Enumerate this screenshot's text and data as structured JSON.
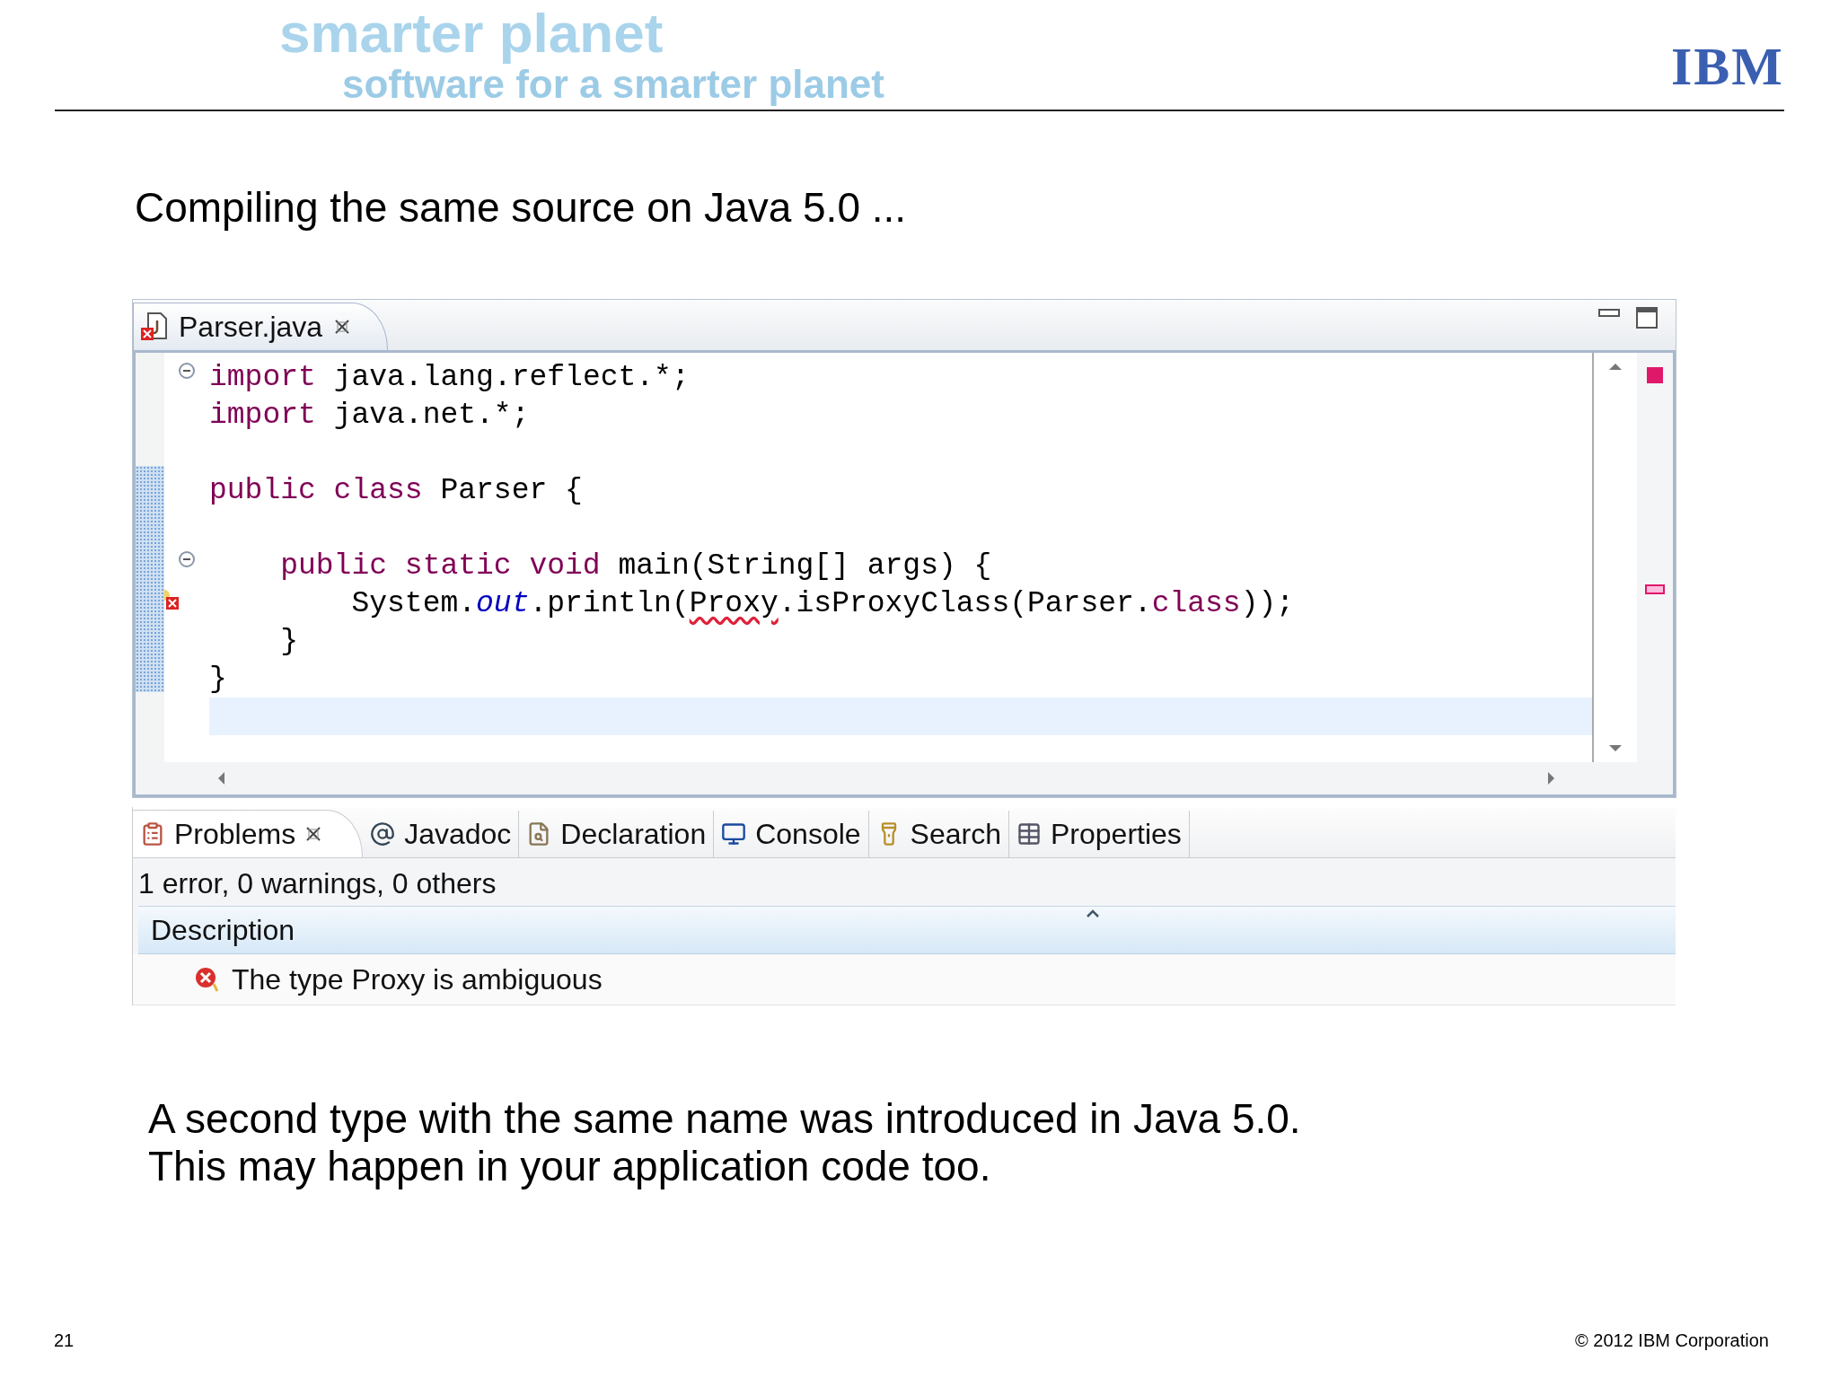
{
  "header": {
    "headline": "smarter planet",
    "tagline": "software for a smarter planet",
    "logo": "IBM"
  },
  "title": "Compiling the same source on Java 5.0 ...",
  "editor": {
    "tabs": [
      {
        "label": "Parser.java",
        "selected": true,
        "error": true
      }
    ],
    "lines": [
      {
        "kind": "code",
        "fold": true,
        "tokens": [
          {
            "text": "import",
            "kind": "keyword"
          },
          {
            "text": " java.lang.reflect.*;",
            "kind": "plain"
          }
        ]
      },
      {
        "kind": "code",
        "tokens": [
          {
            "text": "import",
            "kind": "keyword"
          },
          {
            "text": " java.net.*;",
            "kind": "plain"
          }
        ]
      },
      {
        "kind": "blank"
      },
      {
        "kind": "code",
        "tokens": [
          {
            "text": "public class",
            "kind": "keyword"
          },
          {
            "text": " Parser {",
            "kind": "plain"
          }
        ]
      },
      {
        "kind": "blank"
      },
      {
        "kind": "code",
        "fold": true,
        "tokens": [
          {
            "text": "    public static void",
            "kind": "keyword"
          },
          {
            "text": " main(String[] args) {",
            "kind": "plain"
          }
        ]
      },
      {
        "kind": "code",
        "error": true,
        "tokens": [
          {
            "text": "        System.",
            "kind": "plain"
          },
          {
            "text": "out",
            "kind": "field"
          },
          {
            "text": ".println(",
            "kind": "plain"
          },
          {
            "text": "Proxy",
            "kind": "error"
          },
          {
            "text": ".isProxyClass(Parser.",
            "kind": "plain"
          },
          {
            "text": "class",
            "kind": "keyword"
          },
          {
            "text": "));",
            "kind": "plain"
          }
        ]
      },
      {
        "kind": "code",
        "tokens": [
          {
            "text": "    }",
            "kind": "plain"
          }
        ]
      },
      {
        "kind": "code",
        "tokens": [
          {
            "text": "}",
            "kind": "plain"
          }
        ]
      },
      {
        "kind": "blank",
        "current": true
      }
    ]
  },
  "problems": {
    "tabs": [
      {
        "label": "Problems",
        "selected": true
      },
      {
        "label": "Javadoc",
        "selected": false
      },
      {
        "label": "Declaration",
        "selected": false
      },
      {
        "label": "Console",
        "selected": false
      },
      {
        "label": "Search",
        "selected": false
      },
      {
        "label": "Properties",
        "selected": false
      }
    ],
    "summary": "1 error, 0 warnings, 0 others",
    "columns": [
      "Description"
    ],
    "rows": [
      {
        "description": "The type Proxy is ambiguous"
      }
    ]
  },
  "notes": [
    "A second type with the same name was introduced in Java 5.0.",
    "This may happen in your application code too."
  ],
  "footer": {
    "page": "21",
    "copyright": "© 2012 IBM Corporation"
  }
}
